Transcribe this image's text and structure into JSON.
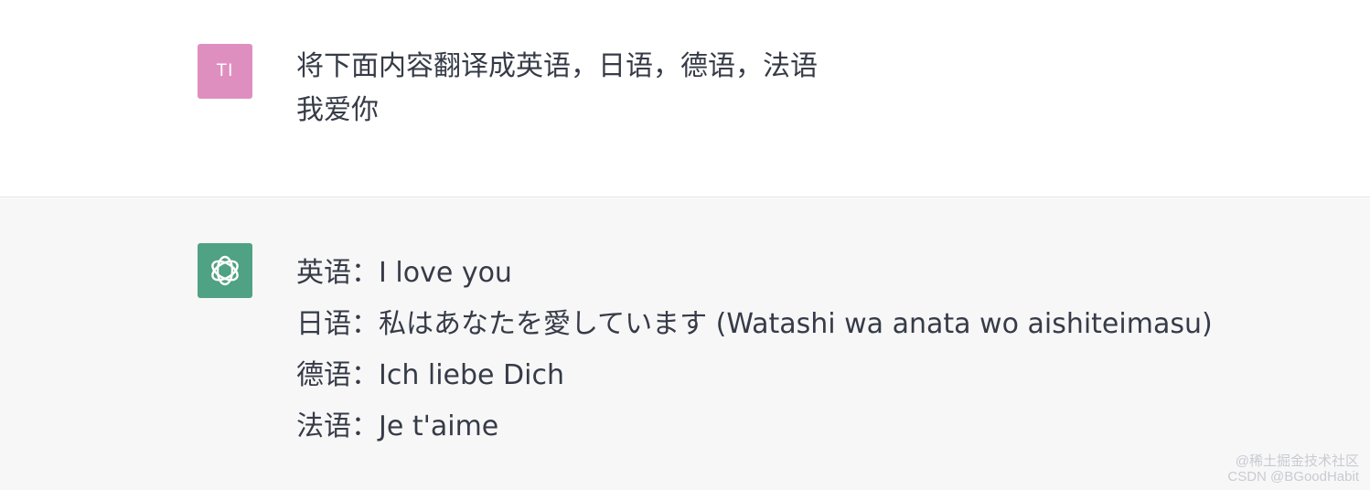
{
  "user_message": {
    "avatar_initials": "TI",
    "avatar_color": "#df8fbf",
    "lines": [
      "将下面内容翻译成英语，日语，德语，法语",
      "我爱你"
    ]
  },
  "assistant_message": {
    "avatar_icon": "openai-logo-icon",
    "avatar_color": "#4fa283",
    "lines": [
      "英语：I love you",
      "日语：私はあなたを愛しています (Watashi wa anata wo aishiteimasu)",
      "德语：Ich liebe Dich",
      "法语：Je t'aime"
    ]
  },
  "watermark": {
    "line1": "@稀土掘金技术社区",
    "line2": "CSDN @BGoodHabit"
  }
}
